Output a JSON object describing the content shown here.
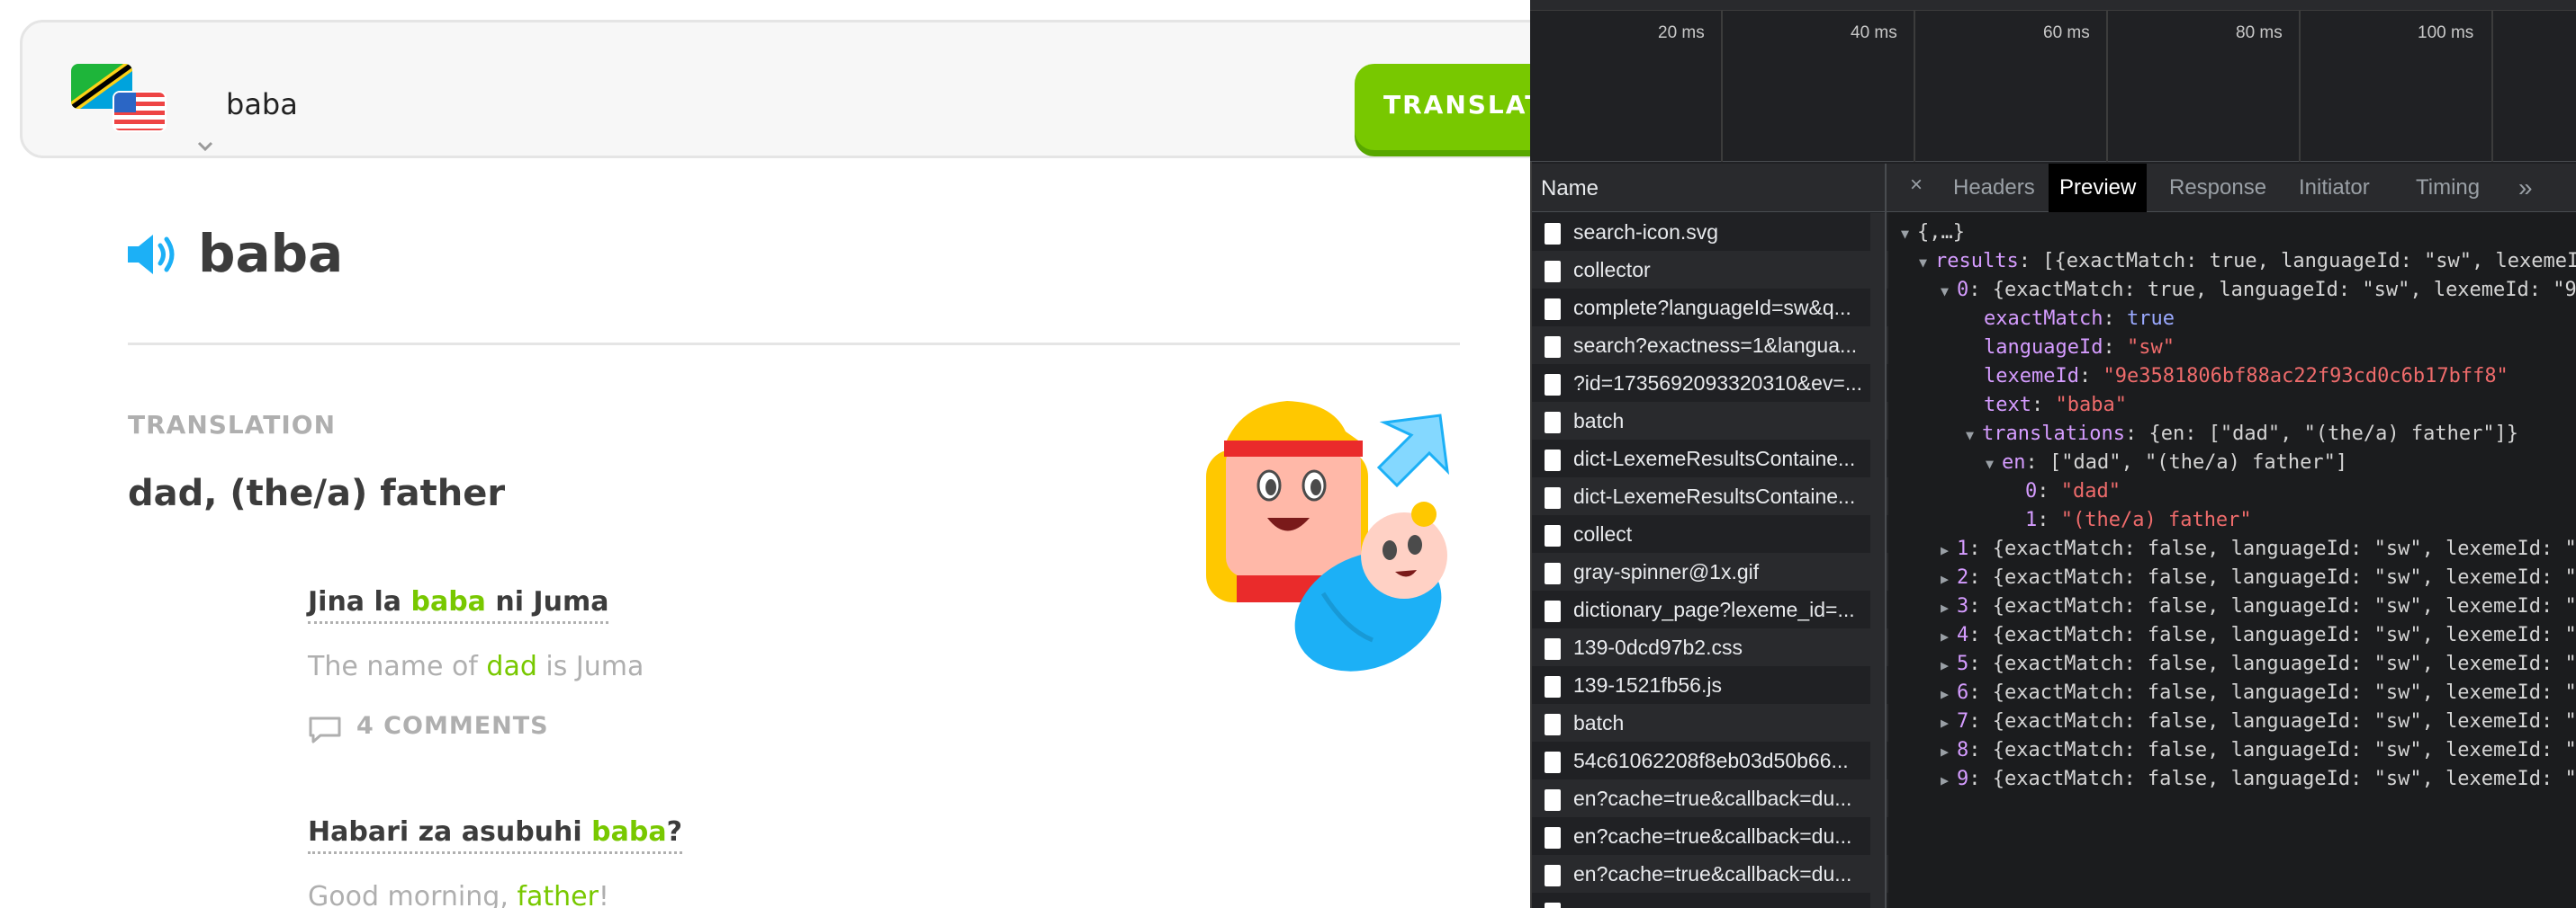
{
  "dictionary": {
    "search_value": "baba",
    "translate_label": "TRANSLATE",
    "word": "baba",
    "section_label": "TRANSLATION",
    "translation": "dad, (the/a) father",
    "examples": [
      {
        "sw_before": "Jina la ",
        "sw_hl": "baba",
        "sw_after": " ni Juma",
        "en_before": "The name of ",
        "en_hl": "dad",
        "en_after": " is Juma"
      },
      {
        "sw_before": "Habari za asubuhi ",
        "sw_hl": "baba",
        "sw_after": "?",
        "en_before": "Good morning, ",
        "en_hl": "father",
        "en_after": "!"
      }
    ],
    "comments_label": "4 COMMENTS"
  },
  "devtools": {
    "timeline_ticks": [
      "20 ms",
      "40 ms",
      "60 ms",
      "80 ms",
      "100 ms"
    ],
    "name_header": "Name",
    "requests": [
      "search-icon.svg",
      "collector",
      "complete?languageId=sw&q...",
      "search?exactness=1&langua...",
      "?id=1735692093320310&ev=...",
      "batch",
      "dict-LexemeResultsContaine...",
      "dict-LexemeResultsContaine...",
      "collect",
      "gray-spinner@1x.gif",
      "dictionary_page?lexeme_id=...",
      "139-0dcd97b2.css",
      "139-1521fb56.js",
      "batch",
      "54c61062208f8eb03d50b66...",
      "en?cache=true&callback=du...",
      "en?cache=true&callback=du...",
      "en?cache=true&callback=du..."
    ],
    "tabs": [
      "Headers",
      "Preview",
      "Response",
      "Initiator",
      "Timing"
    ],
    "active_tab": "Preview",
    "close_glyph": "×",
    "more_glyph": "»",
    "preview": {
      "root": "{,…}",
      "results_summary": "[{exactMatch: true, languageId: \"sw\", lexemeId:",
      "item0_summary": "{exactMatch: true, languageId: \"sw\", lexemeId: \"9",
      "exactMatch": "true",
      "languageId": "\"sw\"",
      "lexemeId": "\"9e3581806bf88ac22f93cd0c6b17bff8\"",
      "text": "\"baba\"",
      "translations_summary": "{en: [\"dad\", \"(the/a) father\"]}",
      "en_summary": "[\"dad\", \"(the/a) father\"]",
      "en0": "\"dad\"",
      "en1": "\"(the/a) father\"",
      "collapsed_summary": "{exactMatch: false, languageId: \"sw\", lexemeId: \""
    }
  }
}
